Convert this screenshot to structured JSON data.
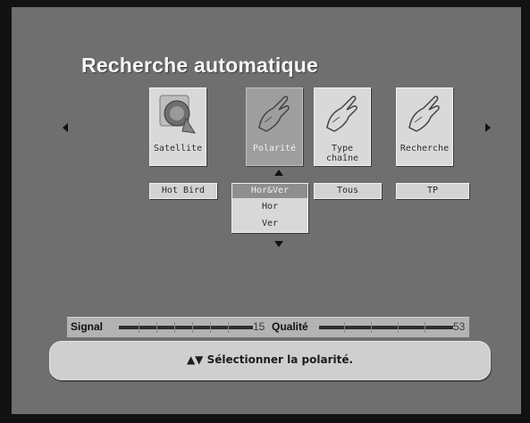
{
  "screen": {
    "title": "Recherche automatique"
  },
  "tabs": [
    {
      "label": "Satellite",
      "icon": "satellite-dish-icon"
    },
    {
      "label": "Polarité",
      "icon": "hand-pointer-icon"
    },
    {
      "label": "Type chaîne",
      "icon": "hand-pointer-icon"
    },
    {
      "label": "Recherche",
      "icon": "hand-pointer-icon"
    }
  ],
  "values": {
    "satellite": "Hot Bird",
    "type": "Tous",
    "search": "TP"
  },
  "polarity_dropdown": {
    "selected": "Hor&Ver",
    "options": [
      "Hor&Ver",
      "Hor",
      "Ver"
    ]
  },
  "signal": {
    "signal_label": "Signal",
    "signal_value": "15",
    "quality_label": "Qualité",
    "quality_value": "53"
  },
  "help": {
    "arrows": "▲▼",
    "text": "Sélectionner la polarité."
  },
  "colors": {
    "background": "#6f6f6f",
    "tile": "#d9d9d9",
    "tile_active": "#9e9e9e"
  }
}
